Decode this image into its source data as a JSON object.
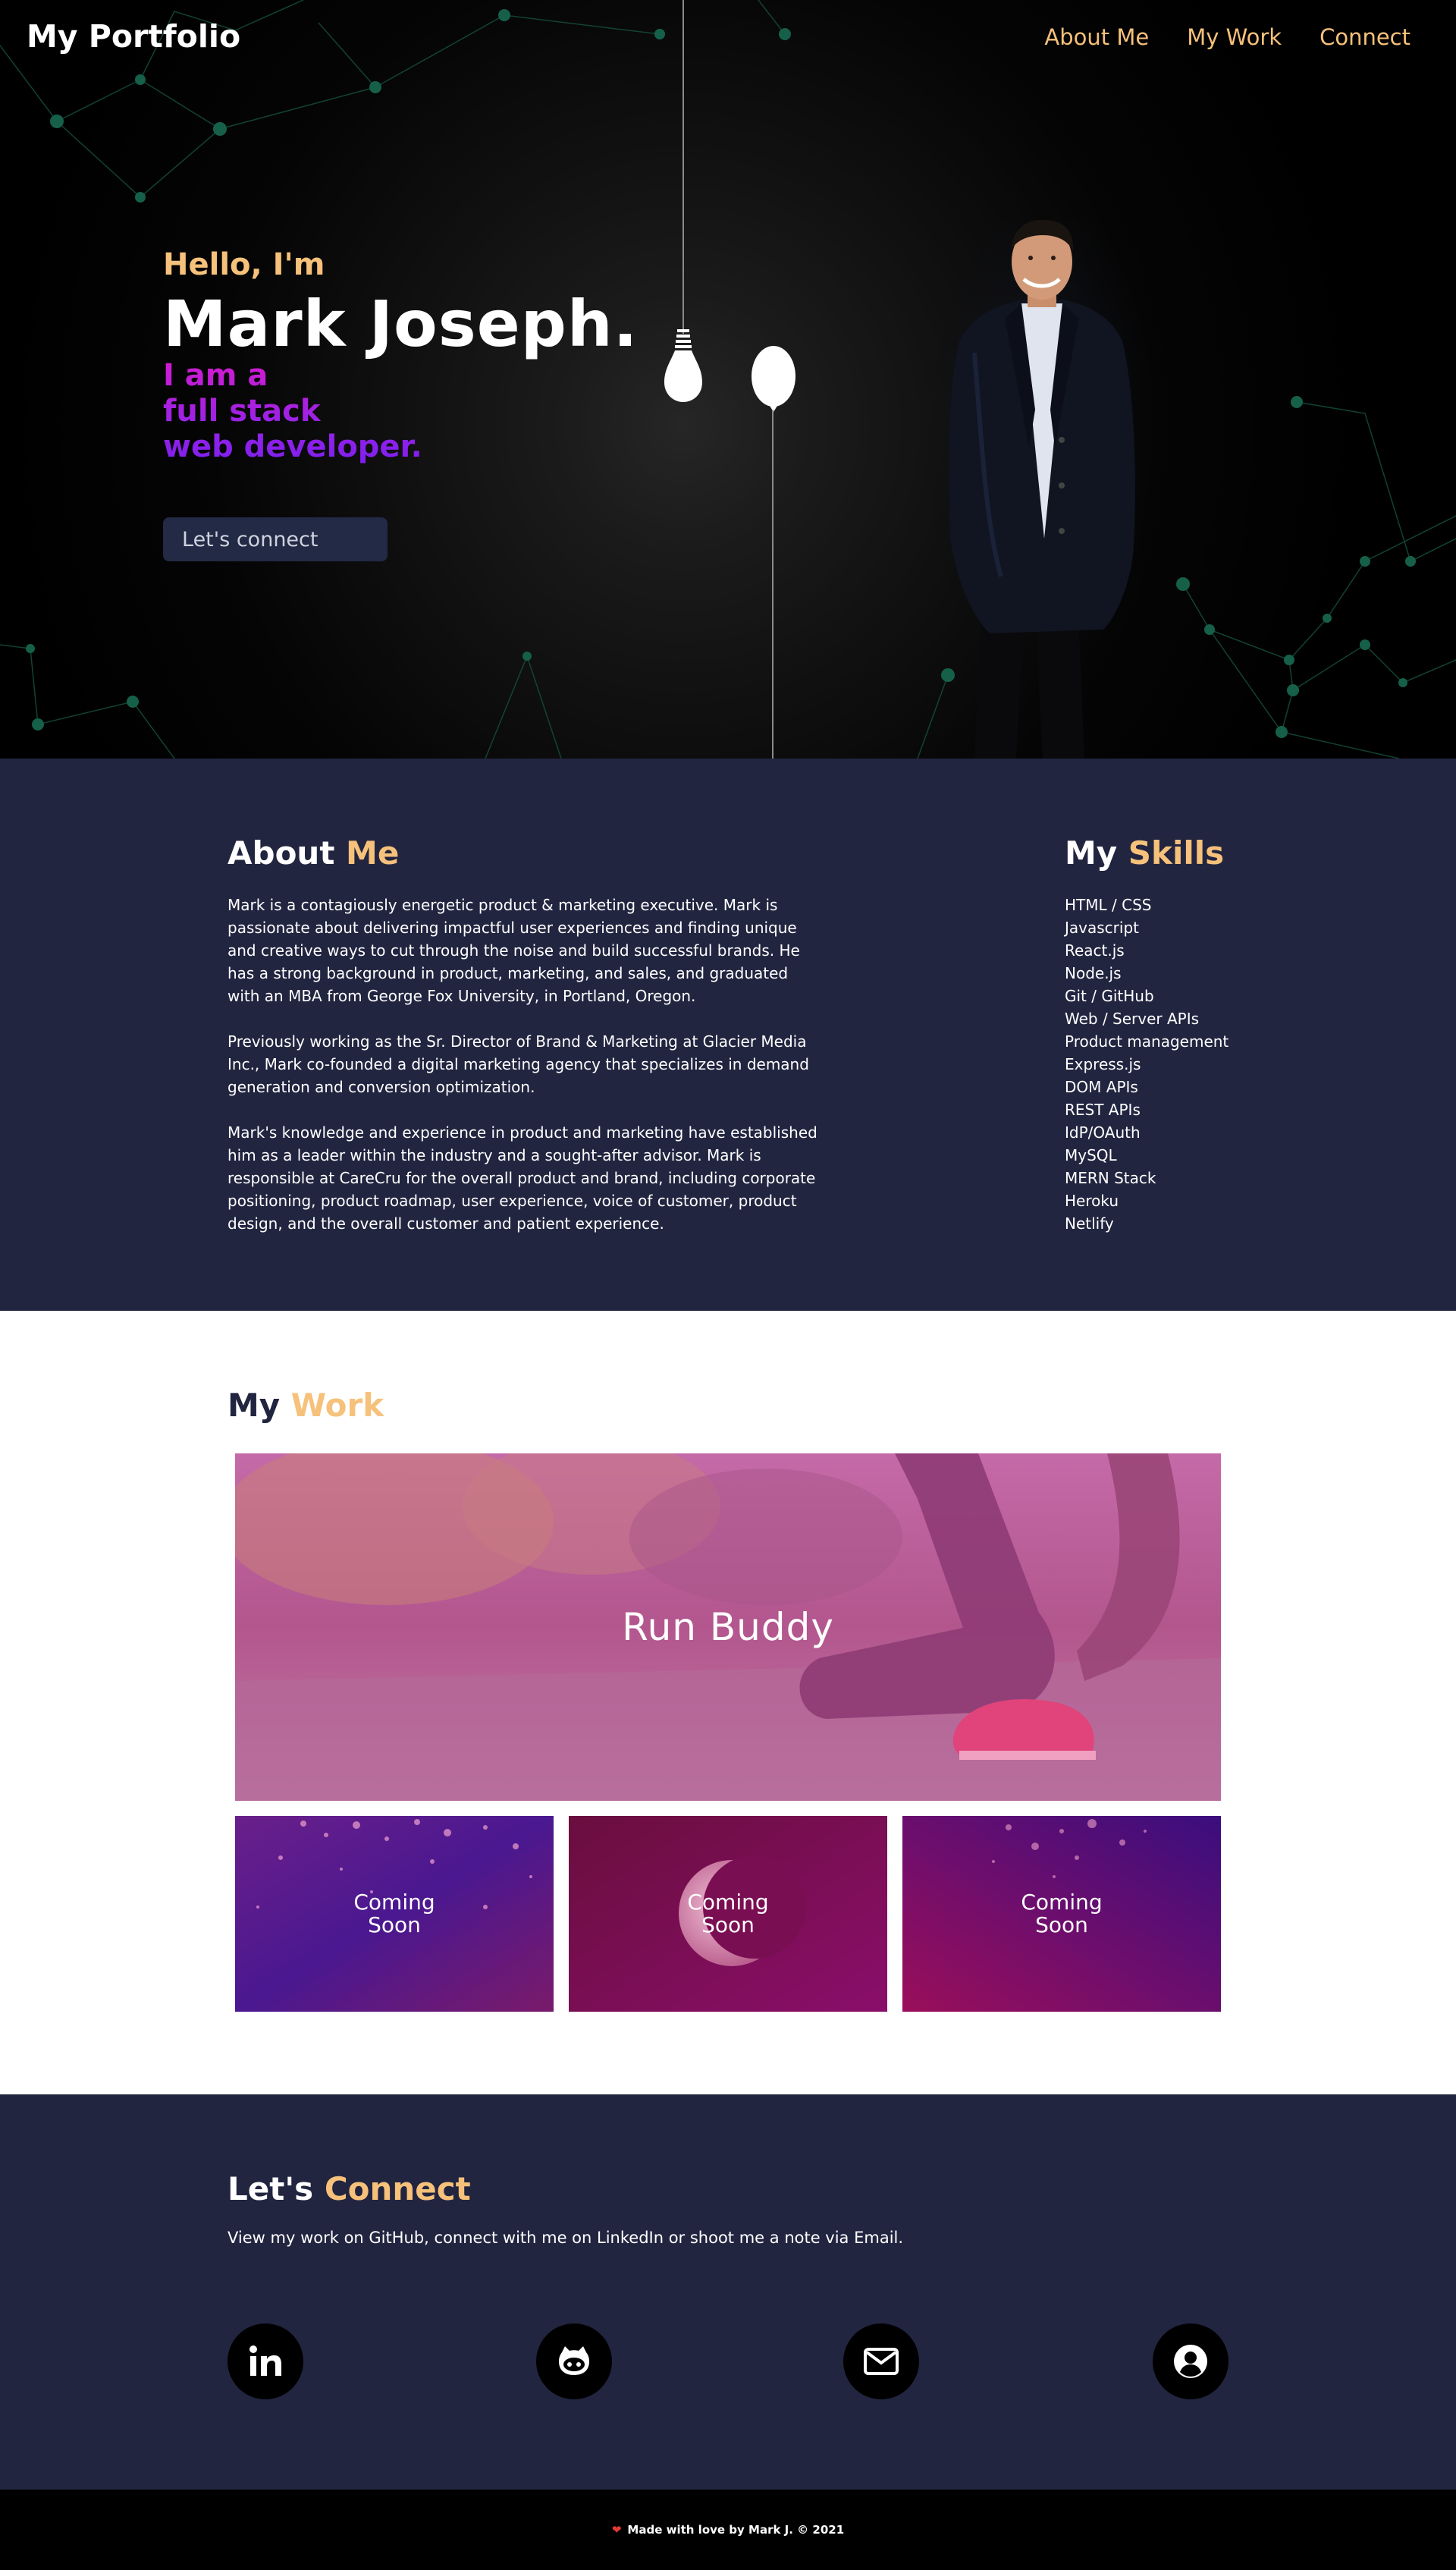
{
  "nav": {
    "brand": "My Portfolio",
    "links": [
      "About Me",
      "My Work",
      "Connect"
    ]
  },
  "hero": {
    "greeting": "Hello, I'm",
    "name": "Mark Joseph.",
    "role_lines": [
      "I am a",
      "full stack",
      "web developer."
    ],
    "cta_label": "Let's connect"
  },
  "about": {
    "title_plain": "About ",
    "title_accent": "Me",
    "paragraphs": [
      "Mark is a contagiously energetic product & marketing executive. Mark is passionate about delivering impactful user experiences and finding unique and creative ways to cut through the noise and build successful brands. He has a strong background in product, marketing, and sales, and graduated with an MBA from George Fox University, in Portland, Oregon.",
      "Previously working as the Sr. Director of Brand & Marketing at Glacier Media Inc., Mark co-founded a digital marketing agency that specializes in demand generation and conversion optimization.",
      "Mark's knowledge and experience in product and marketing have established him as a leader within the industry and a sought-after advisor. Mark is responsible at CareCru for the overall product and brand, including corporate positioning, product roadmap, user experience, voice of customer, product design, and the overall customer and patient experience."
    ]
  },
  "skills": {
    "title_plain": "My ",
    "title_accent": "Skills",
    "items": [
      "HTML / CSS",
      "Javascript",
      "React.js",
      "Node.js",
      "Git / GitHub",
      "Web / Server APIs",
      "Product management",
      "Express.js",
      "DOM APIs",
      "REST APIs",
      "IdP/OAuth",
      "MySQL",
      "MERN Stack",
      "Heroku",
      "Netlify"
    ]
  },
  "work": {
    "title_plain": "My ",
    "title_accent": "Work",
    "featured": "Run Buddy",
    "coming_soon": [
      "Coming\nSoon",
      "Coming\nSoon",
      "Coming\nSoon"
    ]
  },
  "connect": {
    "title_plain": "Let's ",
    "title_accent": "Connect",
    "text": "View my work on GitHub, connect with me on LinkedIn or shoot me a note via Email.",
    "icons": [
      "linkedin-icon",
      "github-icon",
      "email-icon",
      "profile-icon"
    ]
  },
  "footer": {
    "text": "Made with love by Mark J. © 2021"
  },
  "colors": {
    "accent": "#f6c17a",
    "navy": "#222540",
    "role_gradient_start": "#d61bd0",
    "role_gradient_end": "#7d1ff0"
  }
}
